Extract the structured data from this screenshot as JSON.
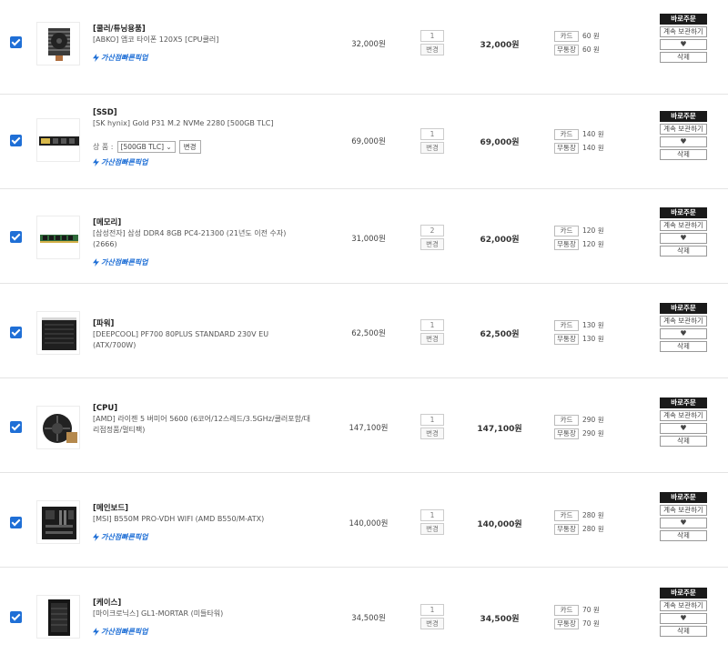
{
  "cart": {
    "items": [
      {
        "category": "[쿨러/튜닝용품]",
        "name": "[ABKO] 앱코 타이폰 120X5 [CPU쿨러]",
        "pickup": "가산점빠른픽업",
        "price": "32,000원",
        "qty": "1",
        "qty_change": "변경",
        "total": "32,000원",
        "points": [
          {
            "label": "카드",
            "value": "60 원"
          },
          {
            "label": "무통장",
            "value": "60 원"
          }
        ],
        "buy": "바로주문",
        "keep": "계속 보관하기",
        "heart": "♥",
        "delete": "삭제"
      },
      {
        "category": "[SSD]",
        "name": "[SK hynix] Gold P31 M.2 NVMe 2280 [500GB TLC]",
        "option_label": "상 품 :",
        "option_value": "[500GB TLC] ⌄",
        "option_change": "변경",
        "pickup": "가산점빠른픽업",
        "price": "69,000원",
        "qty": "1",
        "qty_change": "변경",
        "total": "69,000원",
        "points": [
          {
            "label": "카드",
            "value": "140 원"
          },
          {
            "label": "무통장",
            "value": "140 원"
          }
        ],
        "buy": "바로주문",
        "keep": "계속 보관하기",
        "heart": "♥",
        "delete": "삭제"
      },
      {
        "category": "[메모리]",
        "name": "[삼성전자] 삼성 DDR4 8GB PC4-21300 (21년도 이전 수자) (2666)",
        "pickup": "가산점빠른픽업",
        "price": "31,000원",
        "qty": "2",
        "qty_change": "변경",
        "total": "62,000원",
        "points": [
          {
            "label": "카드",
            "value": "120 원"
          },
          {
            "label": "무통장",
            "value": "120 원"
          }
        ],
        "buy": "바로주문",
        "keep": "계속 보관하기",
        "heart": "♥",
        "delete": "삭제"
      },
      {
        "category": "[파워]",
        "name": "[DEEPCOOL] PF700 80PLUS STANDARD 230V EU (ATX/700W)",
        "price": "62,500원",
        "qty": "1",
        "qty_change": "변경",
        "total": "62,500원",
        "points": [
          {
            "label": "카드",
            "value": "130 원"
          },
          {
            "label": "무통장",
            "value": "130 원"
          }
        ],
        "buy": "바로주문",
        "keep": "계속 보관하기",
        "heart": "♥",
        "delete": "삭제"
      },
      {
        "category": "[CPU]",
        "name": "[AMD] 라이젠 5 버미어 5600 (6코어/12스레드/3.5GHz/쿨러포함/대리점정품/멀티팩)",
        "price": "147,100원",
        "qty": "1",
        "qty_change": "변경",
        "total": "147,100원",
        "points": [
          {
            "label": "카드",
            "value": "290 원"
          },
          {
            "label": "무통장",
            "value": "290 원"
          }
        ],
        "buy": "바로주문",
        "keep": "계속 보관하기",
        "heart": "♥",
        "delete": "삭제"
      },
      {
        "category": "[메인보드]",
        "name": "[MSI] B550M PRO-VDH WIFI (AMD B550/M-ATX)",
        "pickup": "가산점빠른픽업",
        "price": "140,000원",
        "qty": "1",
        "qty_change": "변경",
        "total": "140,000원",
        "points": [
          {
            "label": "카드",
            "value": "280 원"
          },
          {
            "label": "무통장",
            "value": "280 원"
          }
        ],
        "buy": "바로주문",
        "keep": "계속 보관하기",
        "heart": "♥",
        "delete": "삭제"
      },
      {
        "category": "[케이스]",
        "name": "[마이크로닉스] GL1-MORTAR (미들타워)",
        "pickup": "가산점빠른픽업",
        "price": "34,500원",
        "qty": "1",
        "qty_change": "변경",
        "total": "34,500원",
        "points": [
          {
            "label": "카드",
            "value": "70 원"
          },
          {
            "label": "무통장",
            "value": "70 원"
          }
        ],
        "buy": "바로주문",
        "keep": "계속 보관하기",
        "heart": "♥",
        "delete": "삭제"
      }
    ]
  }
}
